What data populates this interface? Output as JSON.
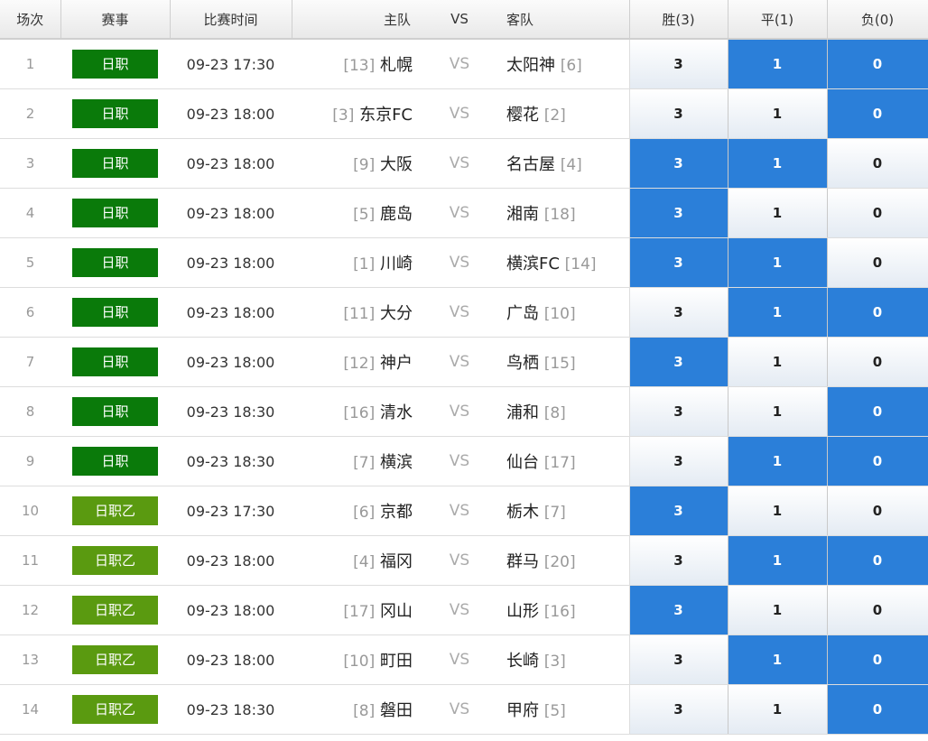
{
  "header": {
    "idx": "场次",
    "league": "赛事",
    "time": "比赛时间",
    "home": "主队",
    "vs": "VS",
    "away": "客队",
    "win": "胜(3)",
    "draw": "平(1)",
    "lose": "负(0)"
  },
  "colors": {
    "league_J1": "#0a7a0a",
    "league_J2": "#5a9a10",
    "selected": "#2b7fd9"
  },
  "rows": [
    {
      "idx": "1",
      "league": "日职",
      "league_key": "J1",
      "time": "09-23 17:30",
      "home_rank": "[13]",
      "home": "札幌",
      "away": "太阳神",
      "away_rank": "[6]",
      "win": "3",
      "draw": "1",
      "lose": "0",
      "win_sel": false,
      "draw_sel": true,
      "lose_sel": true
    },
    {
      "idx": "2",
      "league": "日职",
      "league_key": "J1",
      "time": "09-23 18:00",
      "home_rank": "[3]",
      "home": "东京FC",
      "away": "樱花",
      "away_rank": "[2]",
      "win": "3",
      "draw": "1",
      "lose": "0",
      "win_sel": false,
      "draw_sel": false,
      "lose_sel": true
    },
    {
      "idx": "3",
      "league": "日职",
      "league_key": "J1",
      "time": "09-23 18:00",
      "home_rank": "[9]",
      "home": "大阪",
      "away": "名古屋",
      "away_rank": "[4]",
      "win": "3",
      "draw": "1",
      "lose": "0",
      "win_sel": true,
      "draw_sel": true,
      "lose_sel": false
    },
    {
      "idx": "4",
      "league": "日职",
      "league_key": "J1",
      "time": "09-23 18:00",
      "home_rank": "[5]",
      "home": "鹿岛",
      "away": "湘南",
      "away_rank": "[18]",
      "win": "3",
      "draw": "1",
      "lose": "0",
      "win_sel": true,
      "draw_sel": false,
      "lose_sel": false
    },
    {
      "idx": "5",
      "league": "日职",
      "league_key": "J1",
      "time": "09-23 18:00",
      "home_rank": "[1]",
      "home": "川崎",
      "away": "横滨FC",
      "away_rank": "[14]",
      "win": "3",
      "draw": "1",
      "lose": "0",
      "win_sel": true,
      "draw_sel": true,
      "lose_sel": false
    },
    {
      "idx": "6",
      "league": "日职",
      "league_key": "J1",
      "time": "09-23 18:00",
      "home_rank": "[11]",
      "home": "大分",
      "away": "广岛",
      "away_rank": "[10]",
      "win": "3",
      "draw": "1",
      "lose": "0",
      "win_sel": false,
      "draw_sel": true,
      "lose_sel": true
    },
    {
      "idx": "7",
      "league": "日职",
      "league_key": "J1",
      "time": "09-23 18:00",
      "home_rank": "[12]",
      "home": "神户",
      "away": "鸟栖",
      "away_rank": "[15]",
      "win": "3",
      "draw": "1",
      "lose": "0",
      "win_sel": true,
      "draw_sel": false,
      "lose_sel": false
    },
    {
      "idx": "8",
      "league": "日职",
      "league_key": "J1",
      "time": "09-23 18:30",
      "home_rank": "[16]",
      "home": "清水",
      "away": "浦和",
      "away_rank": "[8]",
      "win": "3",
      "draw": "1",
      "lose": "0",
      "win_sel": false,
      "draw_sel": false,
      "lose_sel": true
    },
    {
      "idx": "9",
      "league": "日职",
      "league_key": "J1",
      "time": "09-23 18:30",
      "home_rank": "[7]",
      "home": "横滨",
      "away": "仙台",
      "away_rank": "[17]",
      "win": "3",
      "draw": "1",
      "lose": "0",
      "win_sel": false,
      "draw_sel": true,
      "lose_sel": true
    },
    {
      "idx": "10",
      "league": "日职乙",
      "league_key": "J2",
      "time": "09-23 17:30",
      "home_rank": "[6]",
      "home": "京都",
      "away": "栃木",
      "away_rank": "[7]",
      "win": "3",
      "draw": "1",
      "lose": "0",
      "win_sel": true,
      "draw_sel": false,
      "lose_sel": false
    },
    {
      "idx": "11",
      "league": "日职乙",
      "league_key": "J2",
      "time": "09-23 18:00",
      "home_rank": "[4]",
      "home": "福冈",
      "away": "群马",
      "away_rank": "[20]",
      "win": "3",
      "draw": "1",
      "lose": "0",
      "win_sel": false,
      "draw_sel": true,
      "lose_sel": true
    },
    {
      "idx": "12",
      "league": "日职乙",
      "league_key": "J2",
      "time": "09-23 18:00",
      "home_rank": "[17]",
      "home": "冈山",
      "away": "山形",
      "away_rank": "[16]",
      "win": "3",
      "draw": "1",
      "lose": "0",
      "win_sel": true,
      "draw_sel": false,
      "lose_sel": false
    },
    {
      "idx": "13",
      "league": "日职乙",
      "league_key": "J2",
      "time": "09-23 18:00",
      "home_rank": "[10]",
      "home": "町田",
      "away": "长崎",
      "away_rank": "[3]",
      "win": "3",
      "draw": "1",
      "lose": "0",
      "win_sel": false,
      "draw_sel": true,
      "lose_sel": true
    },
    {
      "idx": "14",
      "league": "日职乙",
      "league_key": "J2",
      "time": "09-23 18:30",
      "home_rank": "[8]",
      "home": "磐田",
      "away": "甲府",
      "away_rank": "[5]",
      "win": "3",
      "draw": "1",
      "lose": "0",
      "win_sel": false,
      "draw_sel": false,
      "lose_sel": true
    }
  ]
}
